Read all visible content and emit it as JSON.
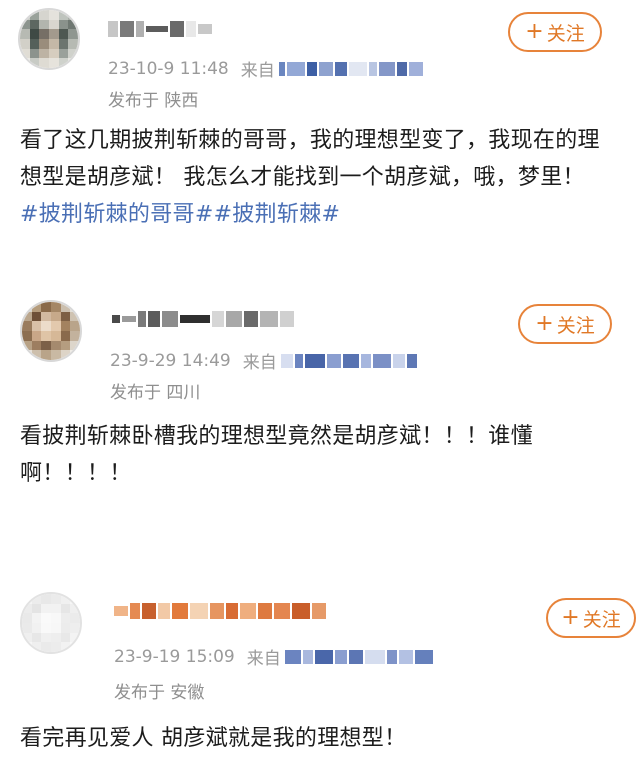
{
  "theme": {
    "accent": "#e7833a",
    "hashtag": "#4a6fb5",
    "meta": "#9a9a9a"
  },
  "posts": [
    {
      "time": "23-10-9 11:48",
      "source_label": "来自",
      "location": "发布于 陕西",
      "follow_label": "关注",
      "body": "看了这几期披荆斩棘的哥哥，我的理想型变了，我现在的理想型是胡彦斌！ 我怎么才能找到一个胡彦斌，哦，梦里！",
      "hashtags": "#披荆斩棘的哥哥##披荆斩棘#"
    },
    {
      "time": "23-9-29 14:49",
      "source_label": "来自",
      "location": "发布于 四川",
      "follow_label": "关注",
      "body": "看披荆斩棘卧槽我的理想型竟然是胡彦斌！！！谁懂啊！！！！"
    },
    {
      "time": "23-9-19 15:09",
      "source_label": "来自",
      "location": "发布于 安徽",
      "follow_label": "关注",
      "body": "看完再见爱人 胡彦斌就是我的理想型！"
    }
  ]
}
